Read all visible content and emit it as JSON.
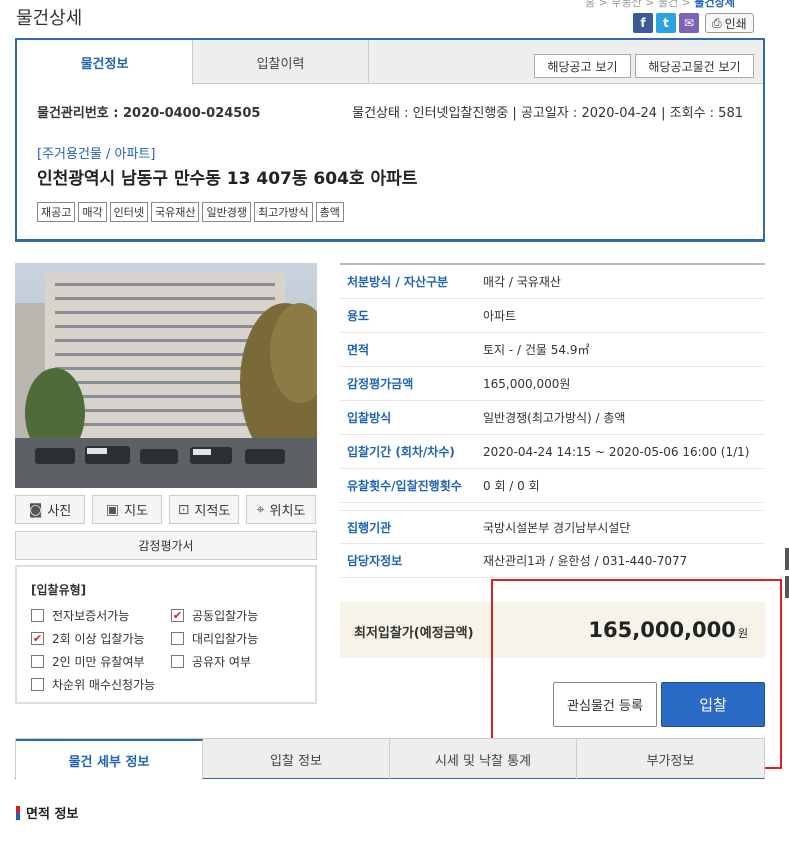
{
  "header": {
    "title": "물건상세",
    "breadcrumb": [
      "홈",
      "부동산",
      "물건",
      "물건상세"
    ]
  },
  "share": {
    "facebook": "f",
    "twitter": "t",
    "mail": "✉",
    "print_label": "인쇄"
  },
  "tabs_top": [
    {
      "label": "물건정보"
    },
    {
      "label": "입찰이력"
    }
  ],
  "buttons_top": {
    "notice": "해당공고 보기",
    "notice_items": "해당공고물건 보기"
  },
  "meta": {
    "mgmt_no": "물건관리번호 : 2020-0400-024505",
    "status": "물건상태 : 인터넷입찰진행중",
    "notice_date": "공고일자 : 2020-04-24",
    "views": "조회수 : 581"
  },
  "category": "[주거용건물 / 아파트]",
  "address": "인천광역시 남동구 만수동 13 407동 604호 아파트",
  "tags": [
    "재공고",
    "매각",
    "인터넷",
    "국유재산",
    "일반경쟁",
    "최고가방식",
    "총액"
  ],
  "photo_buttons": [
    {
      "label": "사진",
      "icon": "camera-icon",
      "glyph": "◙"
    },
    {
      "label": "지도",
      "icon": "map-icon",
      "glyph": "▣"
    },
    {
      "label": "지적도",
      "icon": "cadastral-icon",
      "glyph": "⊡"
    },
    {
      "label": "위치도",
      "icon": "location-icon",
      "glyph": "⌖"
    }
  ],
  "appraisal_label": "감정평가서",
  "bid_type": {
    "title": "[입찰유형]",
    "options": [
      {
        "label": "전자보증서가능",
        "checked": false
      },
      {
        "label": "공동입찰가능",
        "checked": true
      },
      {
        "label": "2회 이상 입찰가능",
        "checked": true
      },
      {
        "label": "대리입찰가능",
        "checked": false
      },
      {
        "label": "2인 미만 유찰여부",
        "checked": false
      },
      {
        "label": "공유자 여부",
        "checked": false
      },
      {
        "label": "차순위 매수신청가능",
        "checked": false
      }
    ]
  },
  "details": [
    {
      "key": "처분방식 / 자산구분",
      "value": "매각 / 국유재산"
    },
    {
      "key": "용도",
      "value": "아파트"
    },
    {
      "key": "면적",
      "value": "토지 - / 건물 54.9㎡"
    },
    {
      "key": "감정평가금액",
      "value": "165,000,000원"
    },
    {
      "key": "입찰방식",
      "value": "일반경쟁(최고가방식) / 총액"
    },
    {
      "key": "입찰기간 (회차/차수)",
      "value": "2020-04-24 14:15 ~ 2020-05-06 16:00 (1/1)"
    },
    {
      "key": "유찰횟수/입찰진행횟수",
      "value": "0 회 / 0 회"
    },
    {
      "key": "집행기관",
      "value": "국방시설본부 경기남부시설단"
    },
    {
      "key": "담당자정보",
      "value": "재산관리1과 / 윤한성 / 031-440-7077"
    }
  ],
  "price": {
    "label": "최저입찰가(예정금액)",
    "value": "165,000,000",
    "unit": "원"
  },
  "actions": {
    "favorite": "관심물건 등록",
    "bid": "입찰"
  },
  "tabs_bottom": [
    {
      "label": "물건 세부 정보"
    },
    {
      "label": "입찰 정보"
    },
    {
      "label": "시세 및 낙찰 통계"
    },
    {
      "label": "부가정보"
    }
  ],
  "section_title": "면적 정보",
  "colors": {
    "accent": "#1e64b4",
    "bid_button": "#2b6ac4",
    "highlight_frame": "#e02020",
    "check": "#d41e1e"
  }
}
